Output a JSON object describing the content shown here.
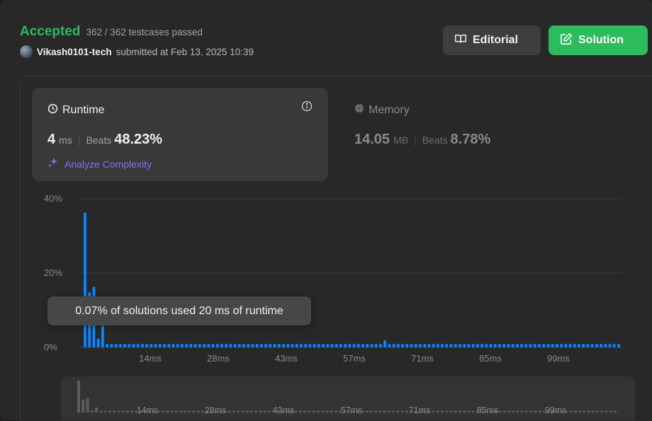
{
  "header": {
    "status": "Accepted",
    "testcases": "362 / 362 testcases passed",
    "username": "Vikash0101-tech",
    "submitted_text": "submitted at Feb 13, 2025 10:39"
  },
  "buttons": {
    "editorial_label": "Editorial",
    "solution_label": "Solution"
  },
  "runtime": {
    "title": "Runtime",
    "value": "4",
    "unit": "ms",
    "beats_label": "Beats",
    "beats_value": "48.23%",
    "analyze_label": "Analyze Complexity"
  },
  "memory": {
    "title": "Memory",
    "value": "14.05",
    "unit": "MB",
    "beats_label": "Beats",
    "beats_value": "8.78%"
  },
  "tooltip": "0.07% of solutions used 20 ms of runtime",
  "colors": {
    "accepted": "#2cbb5d",
    "bar": "#0a84ff",
    "analyze": "#8c6cf0",
    "solution_button": "#2cbb5d"
  },
  "chart_data": {
    "type": "bar",
    "y_tick_labels": [
      "40%",
      "20%",
      "0%"
    ],
    "ylim": [
      0,
      40
    ],
    "x_tick_labels": [
      "14ms",
      "28ms",
      "43ms",
      "57ms",
      "71ms",
      "85ms",
      "99ms"
    ],
    "values": [
      36.3,
      14.8,
      16.3,
      2.4,
      5.8,
      0.9,
      0.9,
      0.9,
      0.9,
      0.9,
      0.9,
      0.9,
      0.9,
      0.9,
      0.9,
      0.9,
      0.9,
      0.9,
      0.9,
      0.9,
      0.9,
      0.9,
      0.9,
      0.9,
      0.9,
      0.9,
      0.9,
      0.9,
      0.9,
      0.9,
      0.9,
      0.9,
      0.9,
      0.9,
      0.9,
      0.9,
      0.9,
      0.9,
      0.9,
      0.9,
      0.9,
      0.9,
      0.9,
      0.9,
      0.9,
      0.9,
      0.9,
      0.9,
      0.9,
      0.9,
      0.9,
      0.9,
      0.9,
      0.9,
      0.9,
      0.9,
      0.9,
      0.9,
      0.9,
      0.9,
      0.9,
      0.9,
      0.9,
      0.9,
      0.9,
      0.9,
      0.9,
      0.9,
      1.9,
      0.9,
      0.9,
      0.9,
      0.9,
      0.9,
      0.9,
      0.9,
      0.9,
      0.9,
      0.9,
      0.9,
      0.9,
      0.9,
      0.9,
      0.9,
      0.9,
      0.9,
      0.9,
      0.9,
      0.9,
      0.9,
      0.9,
      0.9,
      0.9,
      0.9,
      0.9,
      0.9,
      0.9,
      0.9,
      0.9,
      0.9,
      0.9,
      0.9,
      0.9,
      0.9,
      0.9,
      0.9,
      0.9,
      0.9,
      0.9,
      0.9,
      0.9,
      0.9,
      0.9,
      0.9,
      0.9,
      0.9,
      0.9,
      0.9,
      0.9,
      0.9,
      0.9,
      0.9
    ],
    "grid": true,
    "navigator_tick_labels": [
      "14ms",
      "28ms",
      "43ms",
      "57ms",
      "71ms",
      "85ms",
      "99ms"
    ]
  }
}
